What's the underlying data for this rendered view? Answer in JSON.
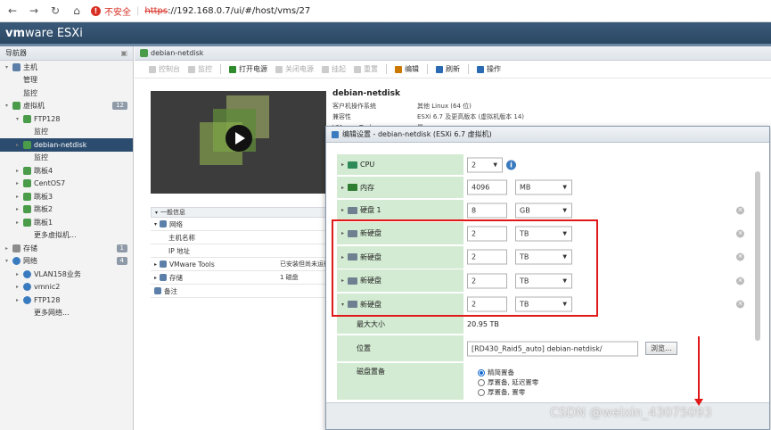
{
  "browser": {
    "insecure_label": "不安全",
    "url_scheme": "https",
    "url_rest": "://192.168.0.7/ui/#/host/vms/27"
  },
  "esxi": {
    "logo_vm": "vm",
    "logo_ware": "ware",
    "logo_esxi": " ESXi"
  },
  "navigator": {
    "title": "导航器",
    "items": [
      {
        "label": "主机",
        "indent": 1,
        "icon": "host",
        "tri": "▾"
      },
      {
        "label": "管理",
        "indent": 2,
        "icon": "",
        "tri": ""
      },
      {
        "label": "监控",
        "indent": 2,
        "icon": "",
        "tri": ""
      },
      {
        "label": "虚拟机",
        "indent": 1,
        "icon": "vm",
        "tri": "▾",
        "count": "12"
      },
      {
        "label": "FTP128",
        "indent": 2,
        "icon": "vm",
        "tri": "▾"
      },
      {
        "label": "监控",
        "indent": 3,
        "icon": "",
        "tri": ""
      },
      {
        "label": "debian-netdisk",
        "indent": 2,
        "icon": "vm",
        "tri": "▸",
        "selected": true
      },
      {
        "label": "监控",
        "indent": 3,
        "icon": "",
        "tri": ""
      },
      {
        "label": "跳板4",
        "indent": 2,
        "icon": "vm",
        "tri": "▸"
      },
      {
        "label": "CentOS7",
        "indent": 2,
        "icon": "vm",
        "tri": "▸"
      },
      {
        "label": "跳板3",
        "indent": 2,
        "icon": "vm",
        "tri": "▸"
      },
      {
        "label": "跳板2",
        "indent": 2,
        "icon": "vm",
        "tri": "▸"
      },
      {
        "label": "跳板1",
        "indent": 2,
        "icon": "vm",
        "tri": "▸"
      },
      {
        "label": "更多虚拟机...",
        "indent": 3,
        "icon": "",
        "tri": ""
      },
      {
        "label": "存储",
        "indent": 1,
        "icon": "storage",
        "tri": "▸",
        "count": "1"
      },
      {
        "label": "网络",
        "indent": 1,
        "icon": "net",
        "tri": "▾",
        "count": "4"
      },
      {
        "label": "VLAN158业务",
        "indent": 2,
        "icon": "net",
        "tri": "▸"
      },
      {
        "label": "vmnic2",
        "indent": 2,
        "icon": "net",
        "tri": "▸"
      },
      {
        "label": "FTP128",
        "indent": 2,
        "icon": "net",
        "tri": "▸"
      },
      {
        "label": "更多网络...",
        "indent": 3,
        "icon": "",
        "tri": ""
      }
    ]
  },
  "vm": {
    "tab_title": "debian-netdisk",
    "toolbar": [
      {
        "label": "控制台",
        "disabled": true
      },
      {
        "label": "监控",
        "disabled": true
      },
      {
        "label": "打开电源",
        "disabled": false,
        "sep_before": true
      },
      {
        "label": "关闭电源",
        "disabled": true
      },
      {
        "label": "挂起",
        "disabled": true
      },
      {
        "label": "重置",
        "disabled": true
      },
      {
        "label": "编辑",
        "disabled": false,
        "sep_before": true
      },
      {
        "label": "刷新",
        "disabled": false,
        "sep_before": true
      },
      {
        "label": "操作",
        "disabled": false,
        "sep_before": true
      }
    ],
    "name": "debian-netdisk",
    "meta": [
      {
        "k": "客户机操作系统",
        "v": "其他 Linux (64 位)"
      },
      {
        "k": "兼容性",
        "v": "ESXi 6.7 及更高版本 (虚拟机版本 14)"
      },
      {
        "k": "VMware Tools",
        "v": "是"
      }
    ],
    "general_title": "一般信息",
    "general": [
      {
        "k": "网络",
        "v": "",
        "indent": 0,
        "tri": "▾"
      },
      {
        "k": "主机名称",
        "v": "",
        "indent": 2,
        "tri": ""
      },
      {
        "k": "IP 地址",
        "v": "",
        "indent": 2,
        "tri": ""
      },
      {
        "k": "VMware Tools",
        "v": "已安装但尚未运行",
        "indent": 0,
        "tri": "▸"
      },
      {
        "k": "存储",
        "v": "1 磁盘",
        "indent": 0,
        "tri": "▸"
      },
      {
        "k": "备注",
        "v": "",
        "indent": 0,
        "tri": ""
      }
    ]
  },
  "modal": {
    "title": "编辑设置 - debian-netdisk (ESXi 6.7 虚拟机)",
    "cpu": {
      "label": "CPU",
      "value": "2"
    },
    "memory": {
      "label": "内存",
      "value": "4096",
      "unit": "MB"
    },
    "disk1": {
      "label": "硬盘 1",
      "value": "8",
      "unit": "GB"
    },
    "new_disks": [
      {
        "label": "新硬盘",
        "value": "2",
        "unit": "TB",
        "expanded": false
      },
      {
        "label": "新硬盘",
        "value": "2",
        "unit": "TB",
        "expanded": false
      },
      {
        "label": "新硬盘",
        "value": "2",
        "unit": "TB",
        "expanded": false
      },
      {
        "label": "新硬盘",
        "value": "2",
        "unit": "TB",
        "expanded": true
      }
    ],
    "max_size": {
      "label": "最大大小",
      "value": "20.95 TB"
    },
    "location": {
      "label": "位置",
      "value": "[RD430_Raid5_auto] debian-netdisk/",
      "browse": "浏览..."
    },
    "provisioning": {
      "label": "磁盘置备",
      "options": [
        {
          "label": "精简置备",
          "selected": true
        },
        {
          "label": "厚置备, 延迟置零",
          "selected": false
        },
        {
          "label": "厚置备, 置零",
          "selected": false
        }
      ]
    }
  },
  "watermark": "CSDN @weixin_43075093",
  "colors": {
    "highlight": "#e01818",
    "selected_nav": "#2b4c6f",
    "label_bg": "#d2ebd2"
  }
}
